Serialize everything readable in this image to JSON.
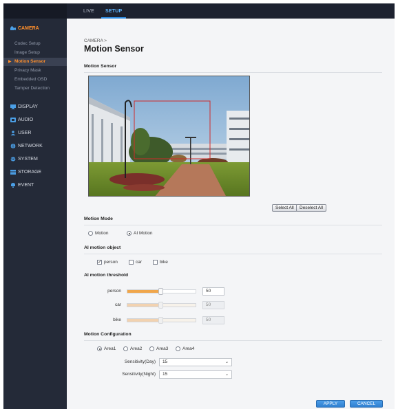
{
  "topbar": {
    "tabs": [
      {
        "label": "LIVE"
      },
      {
        "label": "SETUP"
      }
    ]
  },
  "sidebar": {
    "camera": {
      "label": "CAMERA",
      "items": [
        {
          "label": "Codec Setup"
        },
        {
          "label": "Image Setup"
        },
        {
          "label": "Motion Sensor"
        },
        {
          "label": "Privacy Mask"
        },
        {
          "label": "Embedded OSD"
        },
        {
          "label": "Tamper Detection"
        }
      ]
    },
    "categories": [
      {
        "label": "DISPLAY",
        "icon": "display-icon"
      },
      {
        "label": "AUDIO",
        "icon": "audio-icon"
      },
      {
        "label": "USER",
        "icon": "user-icon"
      },
      {
        "label": "NETWORK",
        "icon": "network-icon"
      },
      {
        "label": "SYSTEM",
        "icon": "gear-icon"
      },
      {
        "label": "STORAGE",
        "icon": "storage-icon"
      },
      {
        "label": "EVENT",
        "icon": "event-icon"
      }
    ]
  },
  "main": {
    "breadcrumb": "CAMERA >",
    "title": "Motion Sensor",
    "motion_sensor_section": "Motion Sensor",
    "select_all": "Select All",
    "deselect_all": "Deselect All",
    "motion_mode": {
      "title": "Motion Mode",
      "options": [
        {
          "label": "Motion"
        },
        {
          "label": "AI Motion"
        }
      ],
      "selected": "AI Motion"
    },
    "ai_object": {
      "title": "AI motion object",
      "items": [
        {
          "label": "person",
          "checked": true
        },
        {
          "label": "car",
          "checked": false
        },
        {
          "label": "bike",
          "checked": false
        }
      ]
    },
    "ai_threshold": {
      "title": "AI motion threshold",
      "rows": [
        {
          "label": "person",
          "value": "50",
          "enabled": true
        },
        {
          "label": "car",
          "value": "50",
          "enabled": false
        },
        {
          "label": "bike",
          "value": "50",
          "enabled": false
        }
      ]
    },
    "motion_config": {
      "title": "Motion Configuration",
      "areas": [
        {
          "label": "Area1"
        },
        {
          "label": "Area2"
        },
        {
          "label": "Area3"
        },
        {
          "label": "Area4"
        }
      ],
      "selected_area": "Area1",
      "sens_day_label": "Sensitivity(Day)",
      "sens_day_value": "15",
      "sens_night_label": "Sensitivity(Night)",
      "sens_night_value": "15"
    },
    "apply": "APPLY",
    "cancel": "CANCEL"
  },
  "colors": {
    "accent_orange": "#ff8f2b",
    "accent_blue": "#2f8de4",
    "sidebar_bg": "#242a38",
    "detection_box": "#d02a2a"
  }
}
